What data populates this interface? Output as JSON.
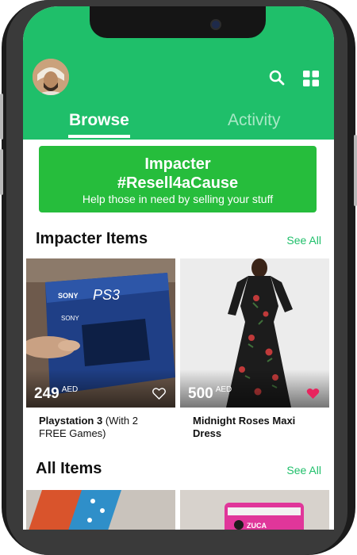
{
  "header": {
    "tabs": [
      {
        "label": "Browse",
        "active": true
      },
      {
        "label": "Activity",
        "active": false
      }
    ],
    "color": "#1fbf6a"
  },
  "banner": {
    "title_line1": "Impacter",
    "title_line2": "#Resell4aCause",
    "subtitle": "Help those in need by selling your stuff",
    "color": "#26bd3c"
  },
  "sections": {
    "impacter": {
      "title": "Impacter Items",
      "see_all": "See All"
    },
    "all": {
      "title": "All Items",
      "see_all": "See All"
    }
  },
  "items": [
    {
      "price": "249",
      "currency": "AED",
      "name_bold": "Playstation 3",
      "name_rest": " (With 2 FREE Games)",
      "favorited": false,
      "image": "ps3-box"
    },
    {
      "price": "500",
      "currency": "AED",
      "name_bold": "Midnight Roses Maxi Dress",
      "name_rest": "",
      "favorited": true,
      "image": "floral-dress"
    }
  ],
  "icons": {
    "search": "search-icon",
    "grid": "grid-icon",
    "heart": "heart-icon"
  },
  "accent_color": "#1fbf6a",
  "heart_color": "#e8245e"
}
